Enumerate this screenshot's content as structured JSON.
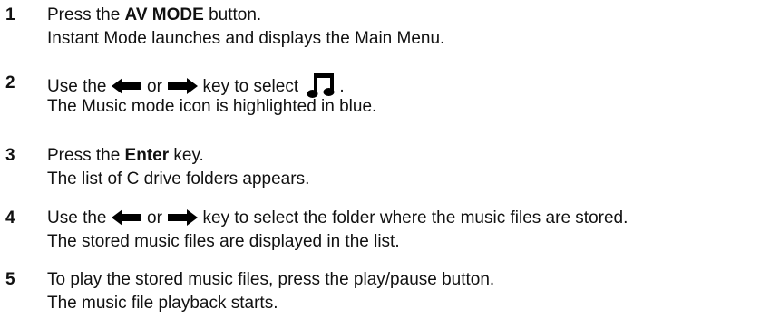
{
  "steps": [
    {
      "number": "1",
      "line1": {
        "before": "Press the ",
        "bold": "AV MODE",
        "after": " button."
      },
      "line2": "Instant Mode launches and displays the Main Menu."
    },
    {
      "number": "2",
      "line1": {
        "t1": "Use the ",
        "t2": " or ",
        "t3": " key to select ",
        "t4": "."
      },
      "line2": "The Music mode icon is highlighted in blue."
    },
    {
      "number": "3",
      "line1": {
        "before": "Press the ",
        "bold": "Enter",
        "after": " key."
      },
      "line2": "The list of C drive folders appears."
    },
    {
      "number": "4",
      "line1": {
        "t1": "Use the ",
        "t2": " or ",
        "t3": " key to select the folder where the music files are stored."
      },
      "line2": "The stored music files are displayed in the list."
    },
    {
      "number": "5",
      "line1": "To play the stored music files, press the play/pause button.",
      "line2": "The music file playback starts."
    }
  ],
  "icons": {
    "left": "left-arrow-icon",
    "right": "right-arrow-icon",
    "music": "music-note-icon"
  },
  "colors": {
    "text": "#111111"
  }
}
